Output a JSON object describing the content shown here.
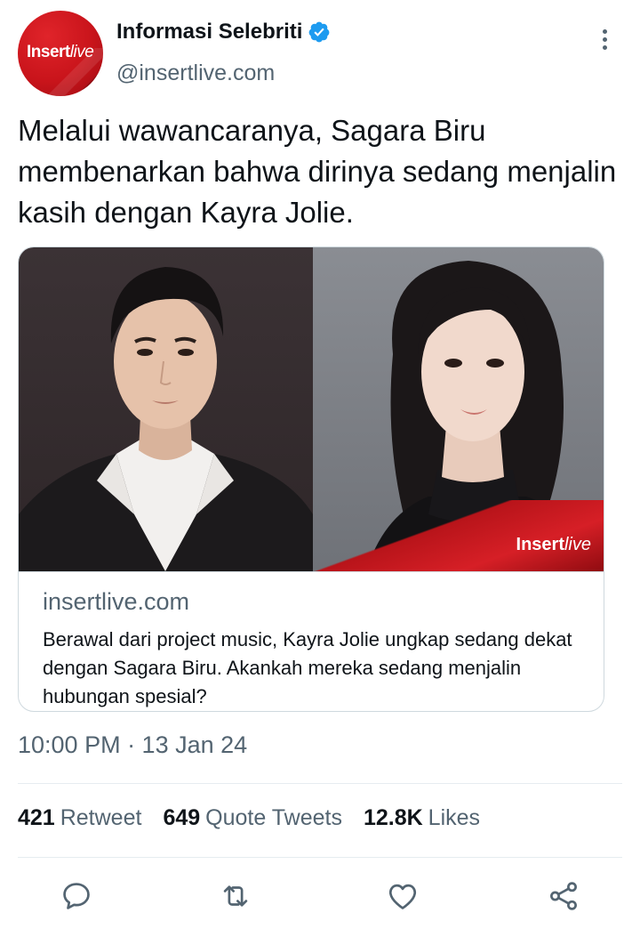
{
  "account": {
    "display_name": "Informasi Selebriti",
    "handle": "@insertlive.com",
    "avatar_logo_main": "Insert",
    "avatar_logo_live": "live",
    "verified": true
  },
  "tweet": {
    "text": "Melalui wawancaranya, Sagara Biru membenarkan bahwa dirinya sedang menjalin kasih dengan Kayra Jolie.",
    "timestamp": "10:00 PM · 13 Jan 24"
  },
  "card": {
    "domain": "insertlive.com",
    "description": "Berawal dari project music, Kayra Jolie ungkap sedang dekat dengan Sagara Biru. Akankah mereka sedang menjalin hubungan spesial?",
    "watermark_main": "Insert",
    "watermark_live": "live"
  },
  "stats": {
    "retweets_count": "421",
    "retweets_label": "Retweet",
    "quotes_count": "649",
    "quotes_label": "Quote Tweets",
    "likes_count": "12.8K",
    "likes_label": "Likes"
  },
  "icons": {
    "reply": "reply-icon",
    "retweet": "retweet-icon",
    "like": "heart-icon",
    "share": "share-icon",
    "more": "more-vertical-icon",
    "verified": "verified-badge-icon"
  },
  "colors": {
    "text_primary": "#0f1419",
    "text_secondary": "#536471",
    "verified_blue": "#1d9bf0",
    "brand_red": "#c9141b",
    "border": "#cfd9de"
  }
}
